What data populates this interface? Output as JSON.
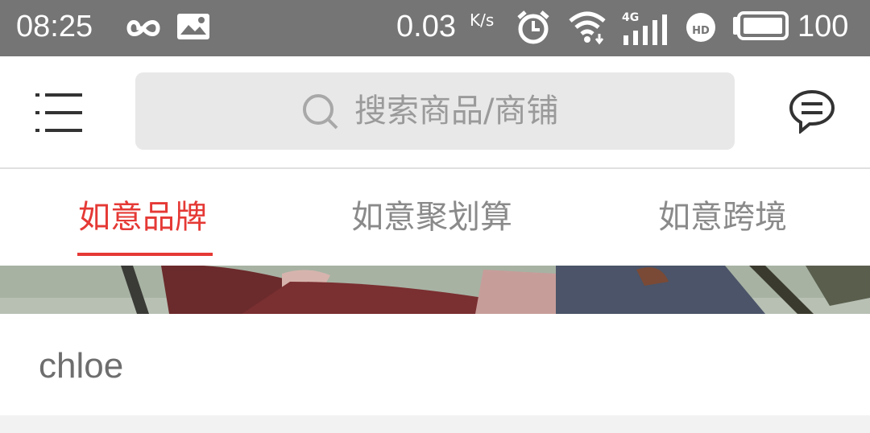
{
  "status_bar": {
    "time": "08:25",
    "network_speed": "0.03",
    "network_speed_unit": "K/s",
    "network_type": "4G",
    "battery": "100",
    "icons": [
      "infinity-icon",
      "gallery-icon",
      "alarm-icon",
      "wifi-icon",
      "signal-icon",
      "hd-voice-icon",
      "battery-icon"
    ]
  },
  "header": {
    "menu_icon": "menu-icon",
    "search_placeholder": "搜索商品/商铺",
    "message_icon": "message-icon"
  },
  "tabs": [
    {
      "label": "如意品牌",
      "active": true
    },
    {
      "label": "如意聚划算",
      "active": false
    },
    {
      "label": "如意跨境",
      "active": false
    }
  ],
  "store": {
    "name": "chloe"
  },
  "colors": {
    "status_bar": "#757575",
    "accent": "#e53935",
    "inactive_tab": "#8a8a8a",
    "search_bg": "#e8e8e8"
  }
}
